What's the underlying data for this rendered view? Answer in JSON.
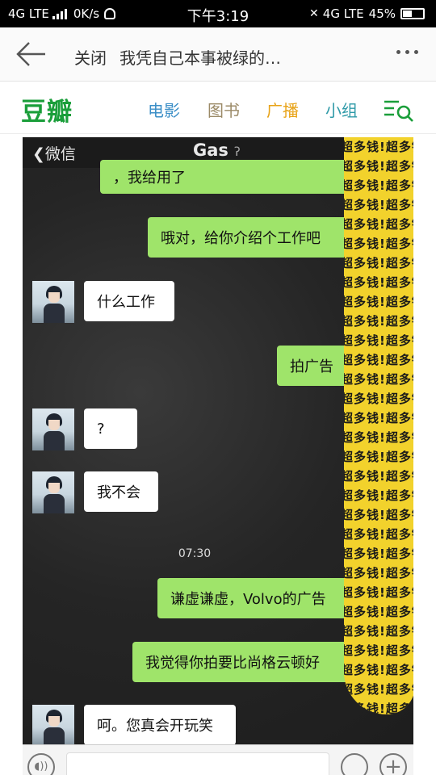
{
  "status_bar": {
    "network_left": "4G LTE",
    "speed": "0K/s",
    "time": "下午3:19",
    "network_right": "4G LTE",
    "battery": "45%"
  },
  "browser_bar": {
    "close_label": "关闭",
    "page_title": "我凭自己本事被绿的…"
  },
  "douban_nav": {
    "logo": "豆瓣",
    "items": [
      {
        "label": "电影",
        "color": "#3c8fc7"
      },
      {
        "label": "图书",
        "color": "#9b8a67"
      },
      {
        "label": "广播",
        "color": "#e8a317"
      },
      {
        "label": "小组",
        "color": "#2f9aa8"
      }
    ],
    "brand_color": "#1a9e3a"
  },
  "wechat": {
    "back_label": "微信",
    "contact_name": "Gas",
    "messages": [
      {
        "side": "right",
        "text": "，我给用了"
      },
      {
        "side": "right",
        "text": "哦对，给你介绍个工作吧"
      },
      {
        "side": "left",
        "text": "什么工作"
      },
      {
        "side": "right",
        "text": "拍广告"
      },
      {
        "side": "left",
        "text": "?"
      },
      {
        "side": "left",
        "text": "我不会"
      },
      {
        "side": "right",
        "text": "谦虚谦虚，Volvo的广告"
      },
      {
        "side": "right",
        "text": "我觉得你拍要比尚格云顿好"
      },
      {
        "side": "left",
        "text": "呵。您真会开玩笑"
      }
    ],
    "timestamp": "07:30",
    "sticker_text": "超多钱!"
  }
}
